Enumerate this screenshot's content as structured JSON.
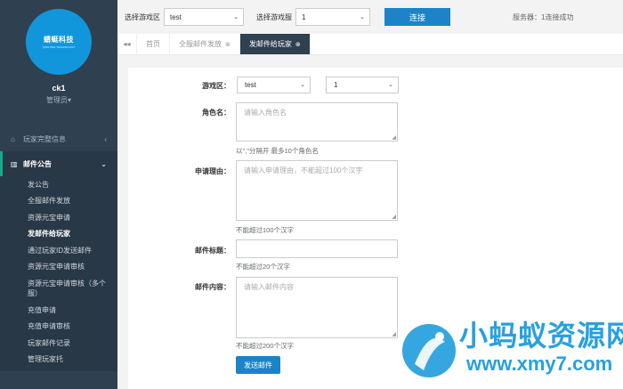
{
  "sidebar": {
    "avatar_text": "蜻蜓科技",
    "avatar_sub": "QINGTING TECHNOLOGY",
    "username": "ck1",
    "role": "管理员▾",
    "menu": [
      {
        "label": "玩家完整信息",
        "icon": "home-icon"
      },
      {
        "label": "邮件公告",
        "icon": "bar-chart-icon"
      }
    ],
    "submenu": [
      "发公告",
      "全服邮件发放",
      "资源元宝申请",
      "发邮件给玩家",
      "通过玩家ID发送邮件",
      "资源元宝申请审核",
      "资源元宝申请审核（多个服）",
      "充值申请",
      "充值申请审核",
      "玩家邮件记录",
      "管理玩家托"
    ]
  },
  "topbar": {
    "zone_label": "选择游戏区",
    "zone_value": "test",
    "server_label": "选择游戏服",
    "server_value": "1",
    "connect_label": "连接",
    "status": "服务器：1连接成功"
  },
  "tabs": {
    "back": "◂◂",
    "items": [
      "首页",
      "全服邮件发放",
      "发邮件给玩家"
    ]
  },
  "form": {
    "zone_label": "游戏区：",
    "zone_value": "test",
    "server_value": "1",
    "role_label": "角色名：",
    "role_placeholder": "请输入角色名",
    "role_help": "以\",\"分隔开 最多10个角色名",
    "reason_label": "申请理由：",
    "reason_placeholder": "请输入申请理由，不能超过100个汉字",
    "reason_help": "不能超过100个汉字",
    "title_label": "邮件标题：",
    "title_help": "不能超过20个汉字",
    "content_label": "邮件内容：",
    "content_placeholder": "请输入邮件内容",
    "content_help": "不能超过200个汉字",
    "send_label": "发送邮件"
  },
  "watermark": {
    "text": "小蚂蚁资源网",
    "url": "www.xmy7.com"
  },
  "colors": {
    "sidebar_bg": "#2f4050",
    "primary": "#1c84c6",
    "accent": "#1296db"
  }
}
